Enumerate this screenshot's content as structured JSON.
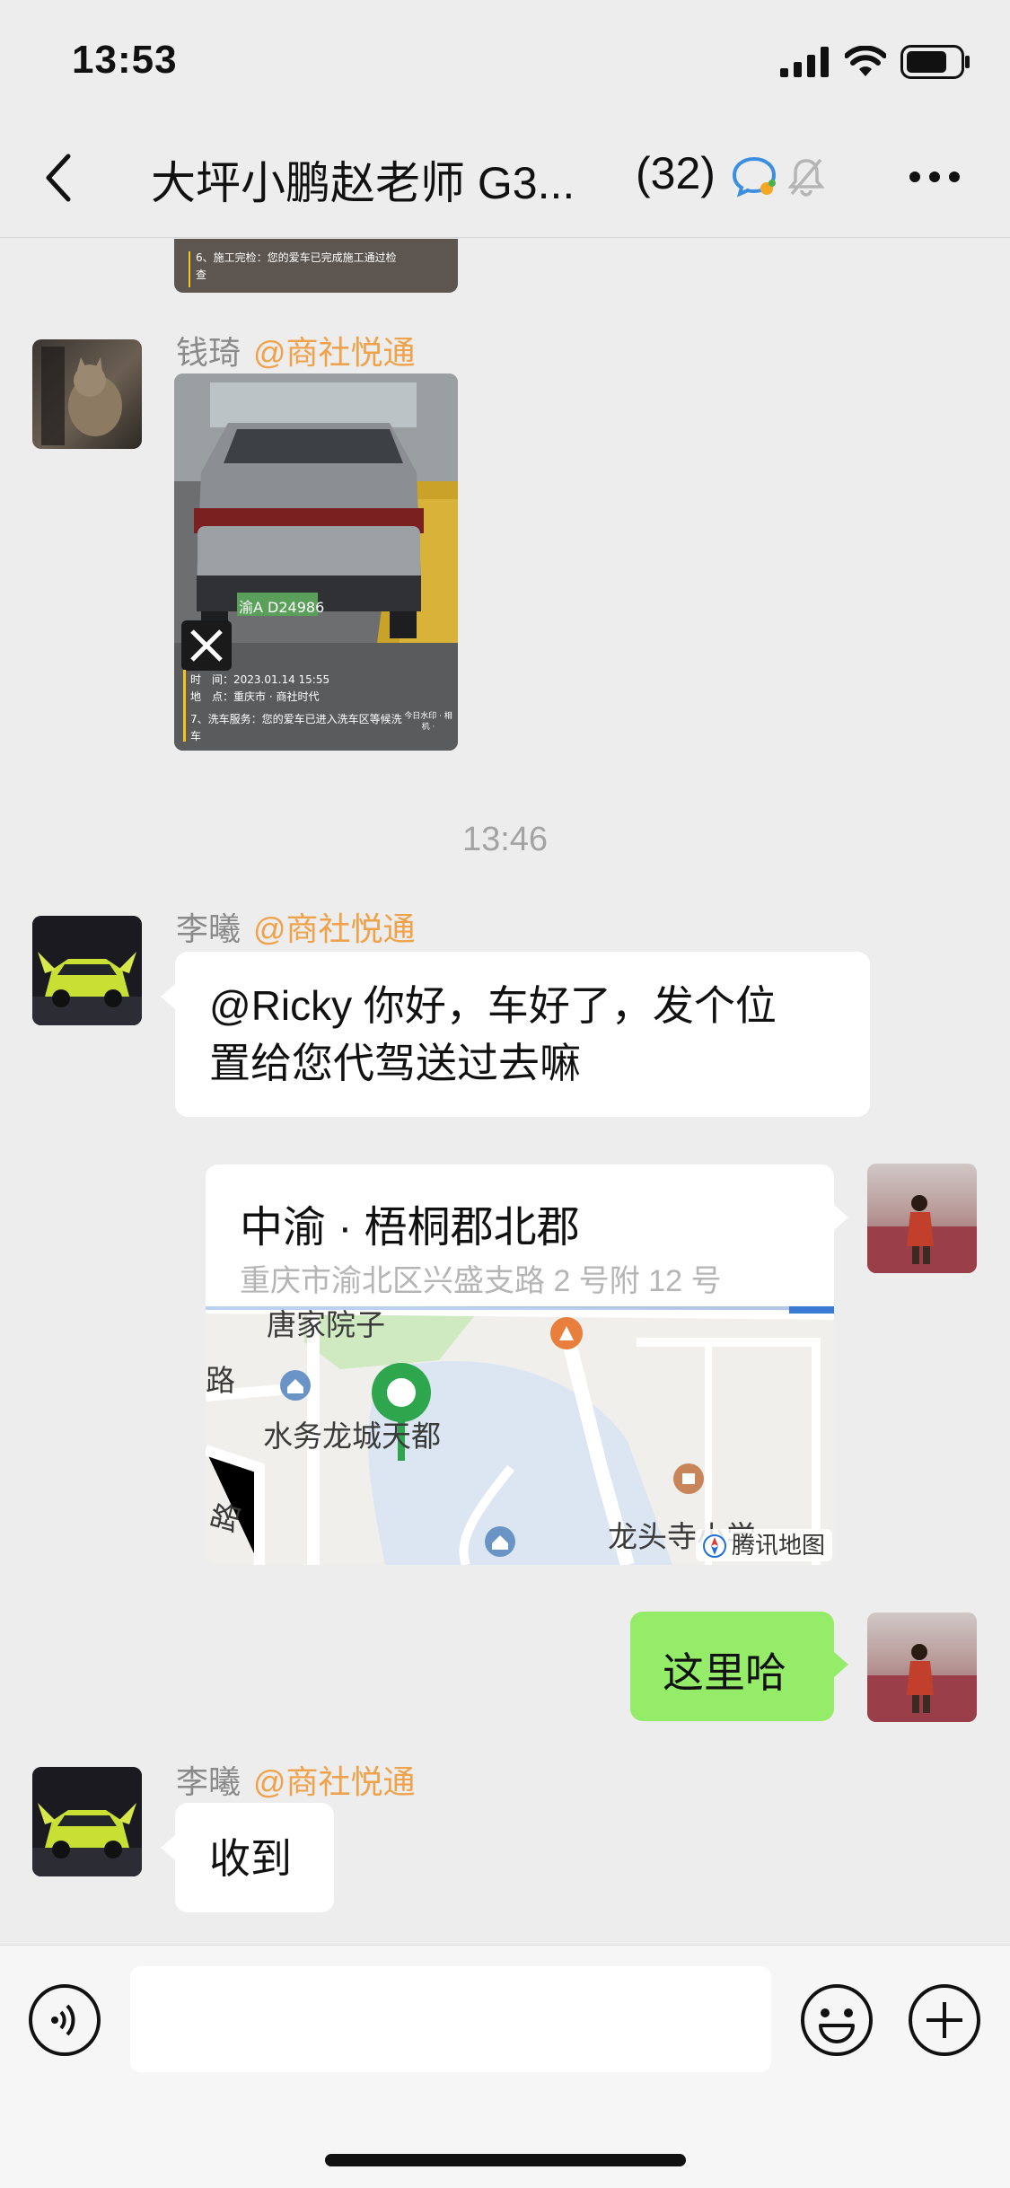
{
  "status_bar": {
    "time": "13:53"
  },
  "nav": {
    "title": "大坪小鹏赵老师 G3...",
    "member_count": "(32)"
  },
  "messages": {
    "qianqi": {
      "sender": "钱琦",
      "org": "@商社悦通",
      "photo_top_caption": "6、施工完检：您的爱车已完成施工通过检查",
      "photo_caption_time": "时　间：2023.01.14 15:55",
      "photo_caption_place": "地　点：重庆市 · 商社时代",
      "photo_caption_service": "7、洗车服务：您的爱车已进入洗车区等候洗车",
      "photo_plate": "渝A D24986",
      "photo_camera_tag": "今日水印 · 相机 ·"
    },
    "timestamp": "13:46",
    "lixi_1": {
      "sender": "李曦",
      "org": "@商社悦通",
      "text_line1": "@Ricky 你好，车好了，发个位",
      "text_line2": "置给您代驾送过去嘛"
    },
    "location": {
      "name": "中渝 · 梧桐郡北郡",
      "address": "重庆市渝北区兴盛支路 2 号附 12 号",
      "map_labels": {
        "tangjia": "唐家院子",
        "lu": "路",
        "shuiwu": "水务龙城天都",
        "longtousi": "龙头寺小学",
        "lu_vertical": "路",
        "provider": "腾讯地图"
      }
    },
    "self_reply": {
      "text": "这里哈"
    },
    "lixi_2": {
      "sender": "李曦",
      "org": "@商社悦通",
      "text": "收到"
    }
  },
  "colors": {
    "background": "#ededed",
    "self_bubble": "#95ec69",
    "org_tag": "#f0a24b",
    "map_pin": "#2ea64d"
  },
  "icons": [
    "back-arrow-icon",
    "chat-bubble-icon",
    "mute-bell-icon",
    "more-icon",
    "voice-icon",
    "emoji-icon",
    "add-icon"
  ]
}
